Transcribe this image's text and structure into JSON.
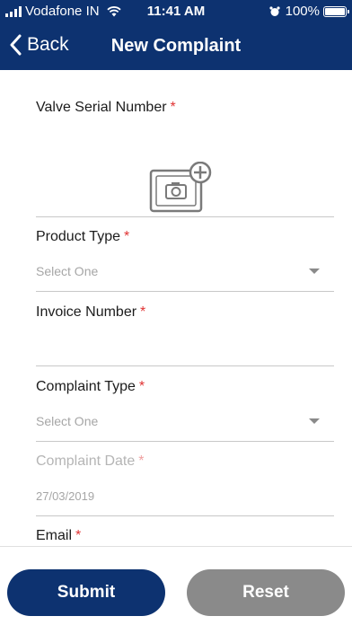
{
  "status_bar": {
    "carrier": "Vodafone IN",
    "time": "11:41 AM",
    "battery": "100%"
  },
  "nav": {
    "back_label": "Back",
    "title": "New Complaint"
  },
  "form": {
    "valve_serial": {
      "label": "Valve Serial Number",
      "required_mark": "*"
    },
    "product_type": {
      "label": "Product Type",
      "required_mark": "*",
      "placeholder": "Select One"
    },
    "invoice_number": {
      "label": "Invoice Number",
      "required_mark": "*",
      "value": ""
    },
    "complaint_type": {
      "label": "Complaint Type",
      "required_mark": "*",
      "placeholder": "Select One"
    },
    "complaint_date": {
      "label": "Complaint Date",
      "required_mark": "*",
      "value": "27/03/2019"
    },
    "email": {
      "label": "Email",
      "required_mark": "*"
    }
  },
  "actions": {
    "submit_label": "Submit",
    "reset_label": "Reset"
  },
  "colors": {
    "primary": "#0d3270",
    "reset": "#8a8a8a",
    "required": "#e03333"
  }
}
